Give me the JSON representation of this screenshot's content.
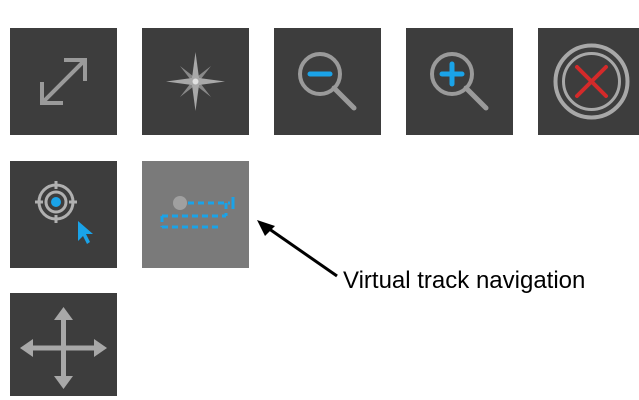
{
  "toolbar": {
    "buttons": [
      {
        "name": "fit-extent",
        "icon": "diagonal-expand-arrows-icon"
      },
      {
        "name": "north-star",
        "icon": "compass-star-icon"
      },
      {
        "name": "zoom-out",
        "icon": "zoom-out-magnifier-icon"
      },
      {
        "name": "zoom-in",
        "icon": "zoom-in-magnifier-icon"
      },
      {
        "name": "cancel",
        "icon": "close-circle-x-icon"
      },
      {
        "name": "locate",
        "icon": "target-pointer-icon"
      },
      {
        "name": "virtual-track",
        "icon": "virtual-track-icon",
        "active": true
      },
      {
        "name": "pan",
        "icon": "four-way-arrows-icon"
      }
    ]
  },
  "callout": {
    "label": "Virtual track navigation"
  },
  "colors": {
    "button_bg": "#3d3d3d",
    "button_active_bg": "#7a7a7a",
    "icon_gray": "#9a9a9a",
    "accent_blue": "#1aa3e8",
    "cancel_red": "#d42a2a"
  }
}
